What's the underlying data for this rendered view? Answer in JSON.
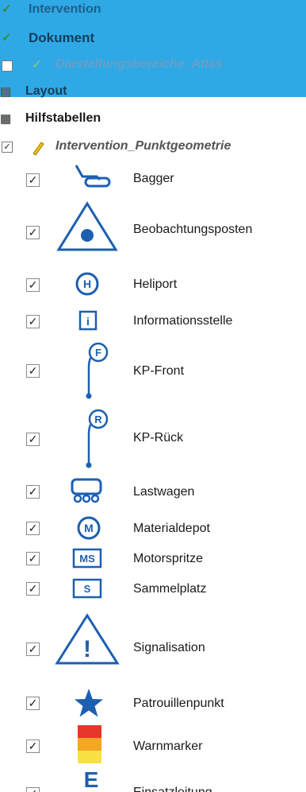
{
  "tree": {
    "top_items": [
      {
        "label": "Intervention"
      },
      {
        "label": "Dokument"
      },
      {
        "label": "Darstellungsbereiche_Atlas"
      },
      {
        "label": "Layout"
      },
      {
        "label": "Hilfstabellen"
      },
      {
        "label": "Intervention_Punktgeometrie"
      }
    ],
    "check_glyph": "✓",
    "layers": [
      {
        "label": "Bagger",
        "icon": "excavator-icon"
      },
      {
        "label": "Beobachtungsposten",
        "icon": "observation-post-icon"
      },
      {
        "label": "Heliport",
        "icon": "heliport-icon",
        "glyph": "H"
      },
      {
        "label": "Informationsstelle",
        "icon": "information-point-icon",
        "glyph": "i"
      },
      {
        "label": "KP-Front",
        "icon": "command-post-front-icon",
        "glyph": "F"
      },
      {
        "label": "KP-Rück",
        "icon": "command-post-rear-icon",
        "glyph": "R"
      },
      {
        "label": "Lastwagen",
        "icon": "truck-icon"
      },
      {
        "label": "Materialdepot",
        "icon": "material-depot-icon",
        "glyph": "M"
      },
      {
        "label": "Motorspritze",
        "icon": "motor-pump-icon",
        "glyph": "MS"
      },
      {
        "label": "Sammelplatz",
        "icon": "assembly-point-icon",
        "glyph": "S"
      },
      {
        "label": "Signalisation",
        "icon": "warning-sign-icon",
        "glyph": "!"
      },
      {
        "label": "Patrouillenpunkt",
        "icon": "star-icon"
      },
      {
        "label": "Warnmarker",
        "icon": "warning-marker-icon"
      },
      {
        "label": "Einsatzleitung",
        "icon": "operations-command-icon",
        "glyph": "E"
      }
    ]
  },
  "colors": {
    "symbol_blue": "#1d5fb0",
    "selection_blue": "#2fa8e6",
    "warn_red": "#e8362a",
    "warn_orange": "#f5a623",
    "warn_yellow": "#f8e045"
  }
}
